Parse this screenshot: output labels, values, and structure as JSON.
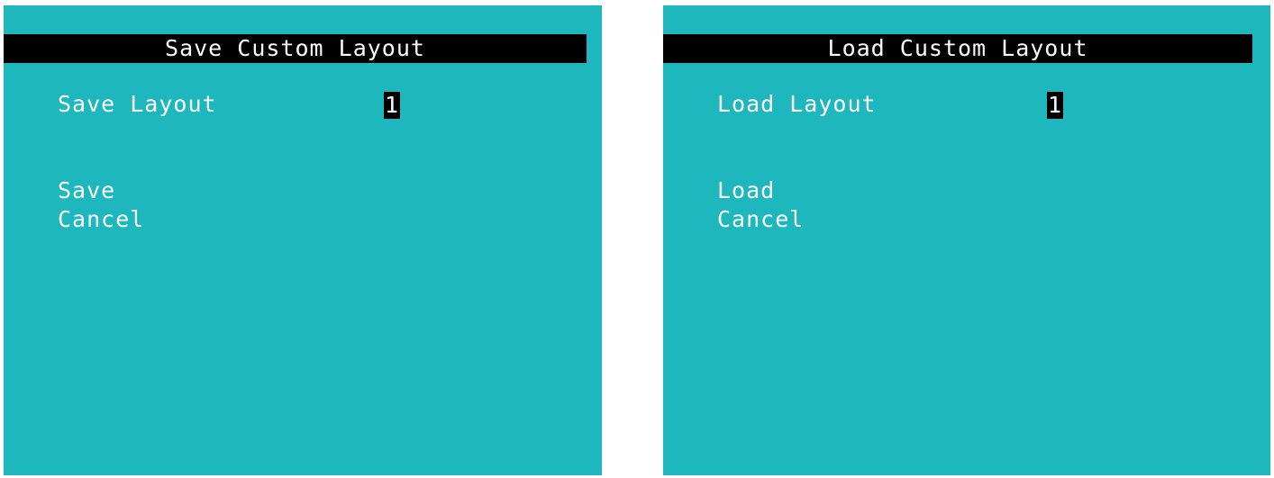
{
  "save_screen": {
    "title": "Save Custom Layout",
    "field_label": "Save Layout",
    "field_value": "1",
    "menu": {
      "action_label": "Save",
      "cancel_label": "Cancel"
    }
  },
  "load_screen": {
    "title": "Load Custom Layout",
    "field_label": "Load Layout",
    "field_value": "1",
    "menu": {
      "action_label": "Load",
      "cancel_label": "Cancel"
    }
  },
  "colors": {
    "screen_background": "#1db7bd",
    "title_bar": "#000000",
    "text": "#ffffff",
    "selection_highlight": "#000000"
  }
}
